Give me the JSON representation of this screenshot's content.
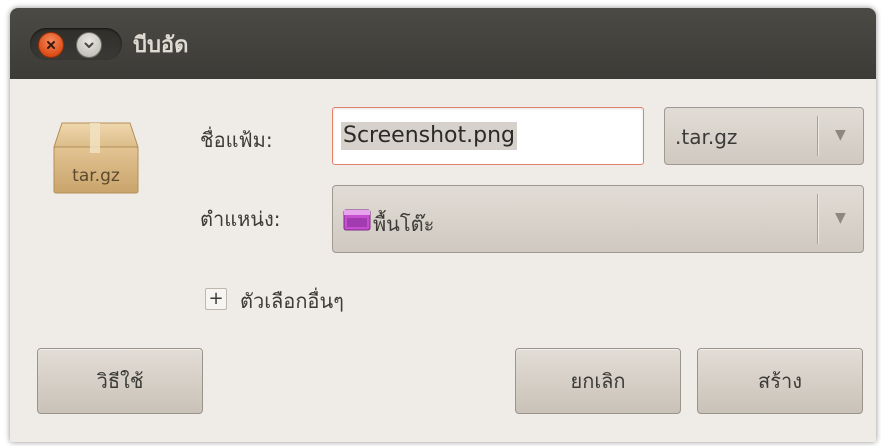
{
  "window": {
    "title": "บีบอัด",
    "close_icon": "close-icon",
    "minimize_icon": "minimize-icon"
  },
  "archive_icon": {
    "label": "tar.gz",
    "icon": "archive-box-icon"
  },
  "form": {
    "filename_label": "ชื่อแฟ้ม:",
    "filename_value": "Screenshot.png",
    "format_value": ".tar.gz",
    "location_label": "ตำแหน่ง:",
    "location_value": "พื้นโต๊ะ",
    "location_icon": "desktop-folder-icon",
    "more_options_label": "ตัวเลือกอื่นๆ",
    "expander_symbol": "+"
  },
  "buttons": {
    "help": "วิธีใช้",
    "cancel": "ยกเลิก",
    "create": "สร้าง"
  },
  "colors": {
    "titlebar": "#3c3b37",
    "close": "#dc4e17",
    "focus_border": "#e2826a",
    "dialog_bg": "#efebe7"
  }
}
